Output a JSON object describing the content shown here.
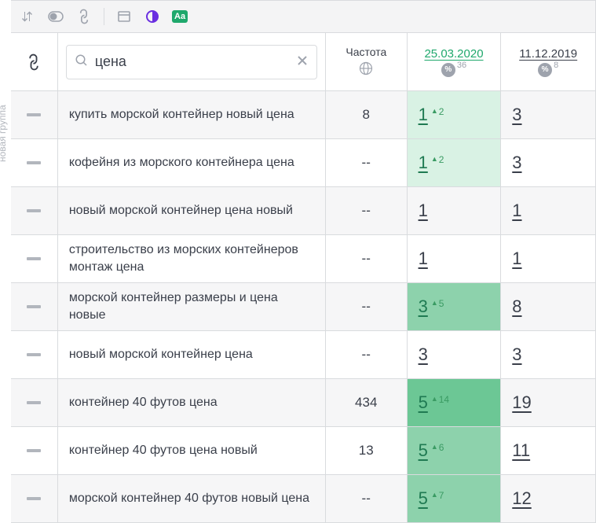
{
  "sidebar": {
    "vertical_label": "новая группа"
  },
  "toolbar": {
    "icons": [
      "sort",
      "toggle",
      "link",
      "sep",
      "window",
      "contrast",
      "aa"
    ]
  },
  "headers": {
    "search_value": "цена",
    "freq_label": "Частота",
    "dates": [
      {
        "label": "25.03.2020",
        "sup": "36",
        "style": "green"
      },
      {
        "label": "11.12.2019",
        "sup": "8",
        "style": "grey"
      }
    ]
  },
  "rows": [
    {
      "kw": "купить морской контейнер новый цена",
      "freq": "8",
      "ranks": [
        {
          "v": "1",
          "delta": "2",
          "hl": 0,
          "g": true
        },
        {
          "v": "3"
        }
      ]
    },
    {
      "kw": "кофейня из морского контейнера цена",
      "freq": "--",
      "ranks": [
        {
          "v": "1",
          "delta": "2",
          "hl": 0,
          "g": true
        },
        {
          "v": "3"
        }
      ]
    },
    {
      "kw": "новый морской контейнер цена новый",
      "freq": "--",
      "ranks": [
        {
          "v": "1"
        },
        {
          "v": "1"
        }
      ]
    },
    {
      "kw": "строительство из морских контейнеров монтаж цена",
      "freq": "--",
      "ranks": [
        {
          "v": "1"
        },
        {
          "v": "1"
        }
      ]
    },
    {
      "kw": "морской контейнер размеры и цена новые",
      "freq": "--",
      "ranks": [
        {
          "v": "3",
          "delta": "5",
          "hl": 2,
          "g": true
        },
        {
          "v": "8"
        }
      ]
    },
    {
      "kw": "новый морской контейнер цена",
      "freq": "--",
      "ranks": [
        {
          "v": "3"
        },
        {
          "v": "3"
        }
      ]
    },
    {
      "kw": "контейнер 40 футов цена",
      "freq": "434",
      "ranks": [
        {
          "v": "5",
          "delta": "14",
          "hl": 3,
          "g": true
        },
        {
          "v": "19"
        }
      ]
    },
    {
      "kw": "контейнер 40 футов цена новый",
      "freq": "13",
      "ranks": [
        {
          "v": "5",
          "delta": "6",
          "hl": 2,
          "g": true
        },
        {
          "v": "11"
        }
      ]
    },
    {
      "kw": "морской контейнер 40 футов новый цена",
      "freq": "--",
      "ranks": [
        {
          "v": "5",
          "delta": "7",
          "hl": 2,
          "g": true
        },
        {
          "v": "12"
        }
      ]
    }
  ]
}
